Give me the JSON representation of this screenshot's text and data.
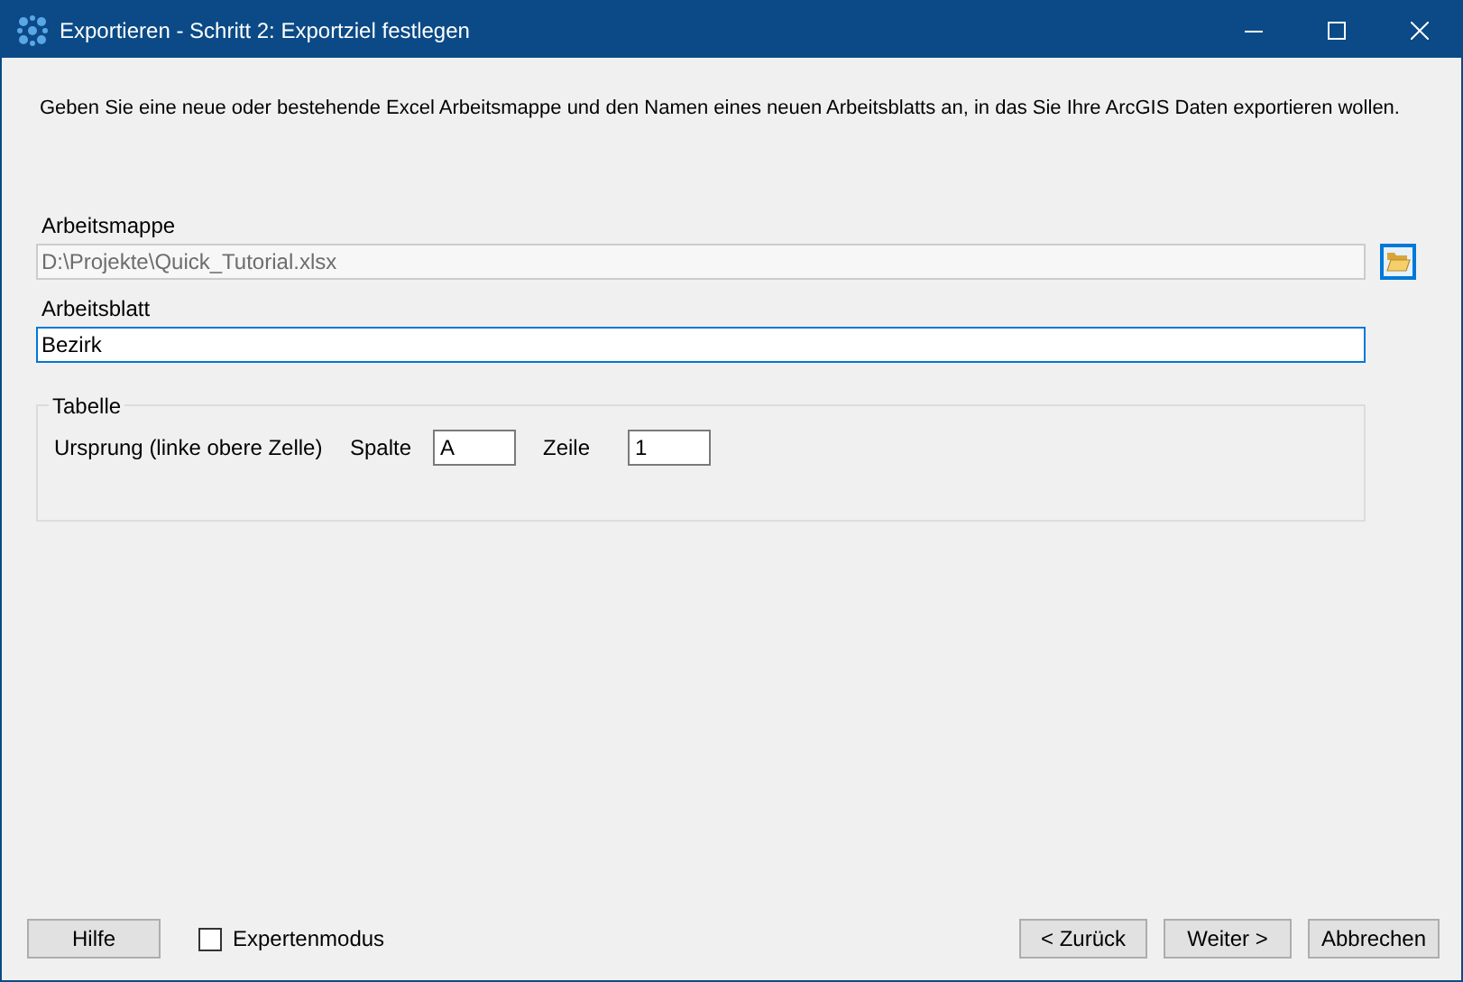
{
  "window": {
    "title": "Exportieren - Schritt 2: Exportziel festlegen"
  },
  "intro": "Geben Sie eine neue oder bestehende Excel Arbeitsmappe und den Namen eines neuen Arbeitsblatts an, in das Sie Ihre ArcGIS Daten exportieren wollen.",
  "workbook": {
    "label": "Arbeitsmappe",
    "value": "D:\\Projekte\\Quick_Tutorial.xlsx",
    "disabled": true
  },
  "sheet": {
    "label": "Arbeitsblatt",
    "value": "Bezirk",
    "focused": true
  },
  "table_group": {
    "title": "Tabelle",
    "origin_label": "Ursprung (linke obere Zelle)",
    "column_label": "Spalte",
    "column_value": "A",
    "row_label": "Zeile",
    "row_value": "1"
  },
  "footer": {
    "help": "Hilfe",
    "expert_mode": {
      "label": "Expertenmodus",
      "checked": false
    },
    "buttons": [
      "< Zurück",
      "Weiter >",
      "Abbrechen"
    ]
  }
}
